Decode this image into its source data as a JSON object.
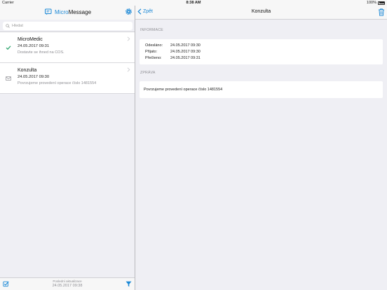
{
  "statusbar": {
    "carrier": "Carrier",
    "time": "8:38 AM",
    "battery": "100%"
  },
  "left": {
    "app_name_part1": "Micro",
    "app_name_part2": "Message",
    "search_placeholder": "Hledat",
    "messages": [
      {
        "title": "MicroMedic",
        "date": "24.05.2017 09:31",
        "preview": "Dostavte se ihned na COS.",
        "status": "check-icon"
      },
      {
        "title": "Konzulta",
        "date": "24.05.2017 09:30",
        "preview": "Povrzujeme provedení operace číslo 1481554",
        "status": "envelope-icon"
      }
    ],
    "footer": {
      "label": "Poslední aktualizace",
      "date": "24.05.2017 09:38"
    }
  },
  "right": {
    "back_label": "Zpět",
    "title": "Konzulta",
    "info_header": "INFORMACE",
    "info": [
      {
        "label": "Odesláno:",
        "value": "24.05.2017 09:30"
      },
      {
        "label": "Přijato:",
        "value": "24.05.2017 09:30"
      },
      {
        "label": "Přečteno:",
        "value": "24.05.2017 09:31"
      }
    ],
    "message_header": "ZPRÁVA",
    "message_body": "Povrzujeme provedení operace číslo 1481554"
  },
  "colors": {
    "accent": "#1a88d6",
    "check": "#2aa36a",
    "background": "#efeff4"
  }
}
